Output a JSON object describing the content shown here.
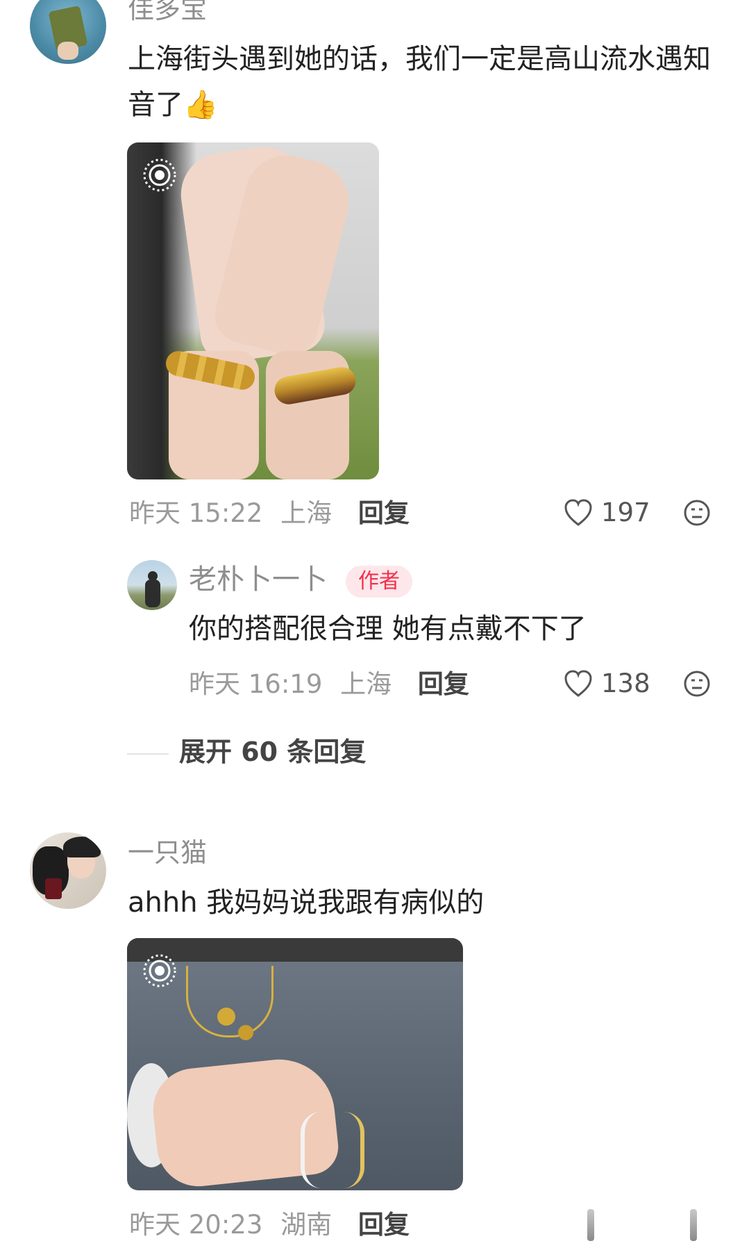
{
  "comments": [
    {
      "username": "佳多宝",
      "text": "上海街头遇到她的话，我们一定是高山流水遇知音了👍",
      "time": "昨天 15:22",
      "location": "上海",
      "reply_label": "回复",
      "likes": "197",
      "reply": {
        "username": "老朴卜一卜",
        "badge": "作者",
        "text": "你的搭配很合理 她有点戴不下了",
        "time": "昨天 16:19",
        "location": "上海",
        "reply_label": "回复",
        "likes": "138"
      },
      "expand_label": "展开 60 条回复"
    },
    {
      "username": "一只猫",
      "text": "ahhh 我妈妈说我跟有病似的",
      "time": "昨天 20:23",
      "location": "湖南",
      "reply_label": "回复"
    }
  ],
  "icons": {
    "like": "heart-outline-icon",
    "dislike": "meh-face-icon",
    "live_photo": "live-photo-icon"
  },
  "colors": {
    "author_badge_bg": "#fde7ea",
    "author_badge_text": "#f2304b",
    "meta_text": "#9a9a9a"
  }
}
